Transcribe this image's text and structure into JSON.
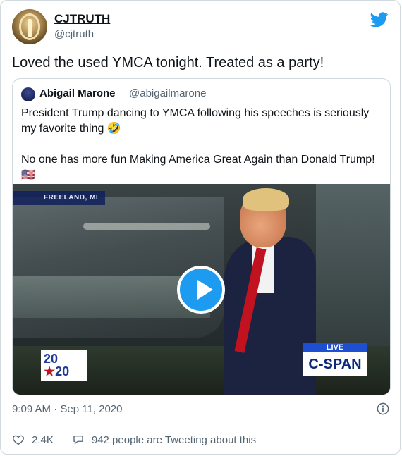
{
  "author": {
    "display_name": "CJTRUTH",
    "handle": "@cjtruth"
  },
  "tweet": {
    "text": "Loved the used YMCA tonight. Treated as a party!",
    "timestamp": "9:09 AM · Sep 11, 2020",
    "likes": "2.4K",
    "conversation": "942 people are Tweeting about this"
  },
  "quoted": {
    "display_name": "Abigail Marone",
    "handle": "@abigailmarone",
    "paragraph1": "President Trump dancing to YMCA following his speeches is seriously my favorite thing 🤣",
    "paragraph2": "No one has more fun Making America Great Again than Donald Trump! 🇺🇸",
    "video": {
      "location": "FREELAND, MI",
      "badge_2020_top": "20",
      "badge_2020_bottom": "20",
      "live": "LIVE",
      "network": "C-SPAN"
    }
  },
  "colors": {
    "accent": "#1d9bf0",
    "text": "#0f1419",
    "muted": "#536471"
  },
  "icons": [
    "twitter-bird-icon",
    "play-icon",
    "info-icon",
    "heart-icon",
    "speech-bubble-icon"
  ]
}
